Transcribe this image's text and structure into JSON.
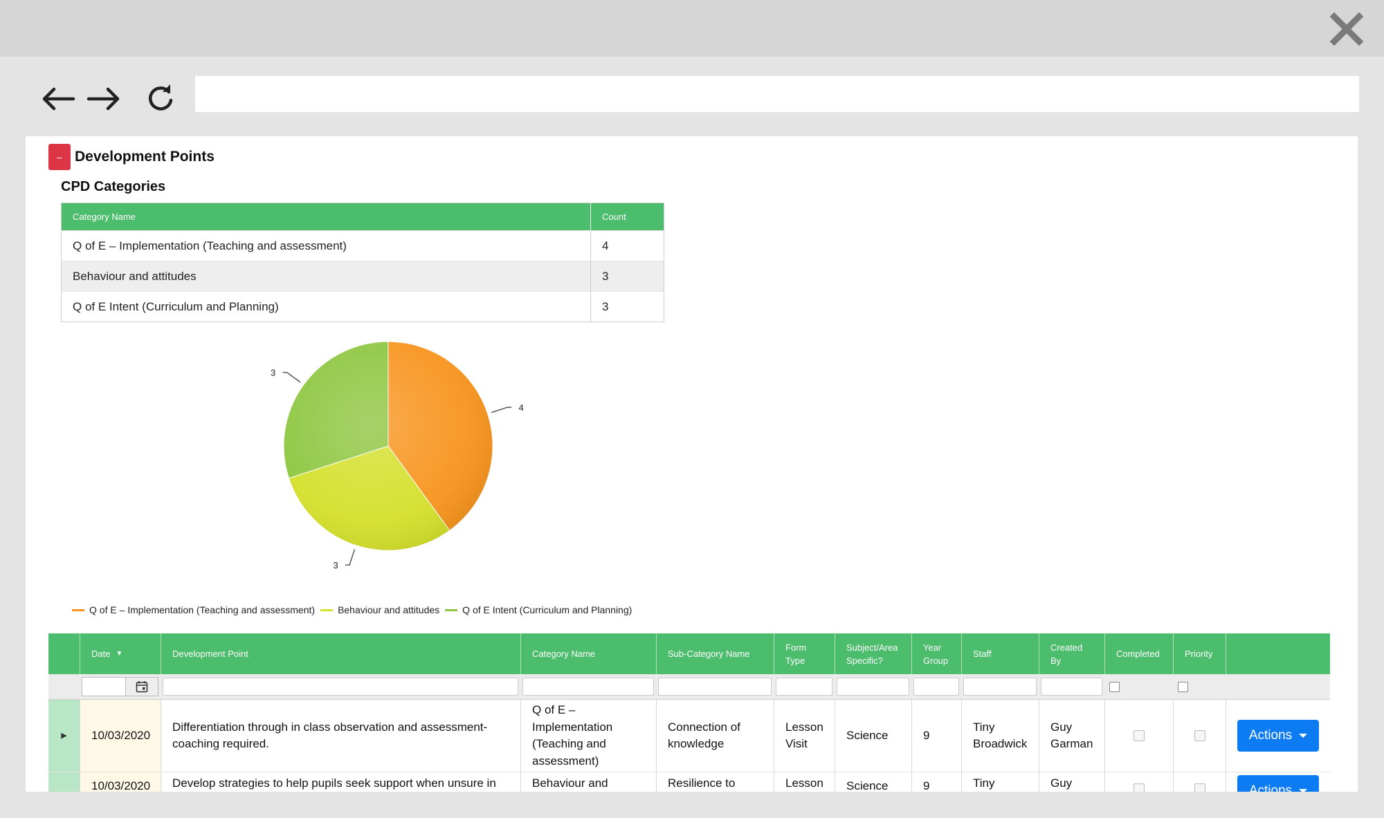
{
  "browser": {
    "address": ""
  },
  "section": {
    "collapse_label": "–",
    "title": "Development Points",
    "subtitle": "CPD Categories"
  },
  "category_table": {
    "headers": [
      "Category Name",
      "Count"
    ],
    "rows": [
      {
        "name": "Q of E – Implementation (Teaching and assessment)",
        "count": "4"
      },
      {
        "name": "Behaviour and attitudes",
        "count": "3"
      },
      {
        "name": "Q of E Intent (Curriculum and Planning)",
        "count": "3"
      }
    ]
  },
  "chart_data": {
    "type": "pie",
    "labels": [
      "Q of E – Implementation (Teaching and assessment)",
      "Behaviour and attitudes",
      "Q of E Intent (Curriculum and Planning)"
    ],
    "values": [
      4,
      3,
      3
    ],
    "colors": [
      "#f7941d",
      "#d4e02a",
      "#8dc63f"
    ],
    "data_labels": [
      "4",
      "3",
      "3"
    ],
    "legend_position": "bottom-left"
  },
  "grid": {
    "headers": {
      "date": "Date",
      "development_point": "Development Point",
      "category_name": "Category Name",
      "sub_category_name": "Sub-Category Name",
      "form_type": "Form Type",
      "subject_area": "Subject/Area Specific?",
      "year_group": "Year Group",
      "staff": "Staff",
      "created_by": "Created By",
      "completed": "Completed",
      "priority": "Priority"
    },
    "rows": [
      {
        "date": "10/03/2020",
        "development_point": "Differentiation through in class observation and assessment- coaching required.",
        "category_name": "Q of E – Implementation (Teaching and assessment)",
        "sub_category_name": "Connection of knowledge",
        "form_type": "Lesson Visit",
        "subject_area": "Science",
        "year_group": "9",
        "staff": "Tiny Broadwick",
        "created_by": "Guy Garman",
        "actions": "Actions"
      },
      {
        "date": "10/03/2020",
        "development_point": "Develop strategies to help pupils seek support when unsure in",
        "category_name": "Behaviour and",
        "sub_category_name": "Resilience to",
        "form_type": "Lesson",
        "subject_area": "Science",
        "year_group": "9",
        "staff": "Tiny",
        "created_by": "Guy",
        "actions": "Actions"
      }
    ]
  }
}
